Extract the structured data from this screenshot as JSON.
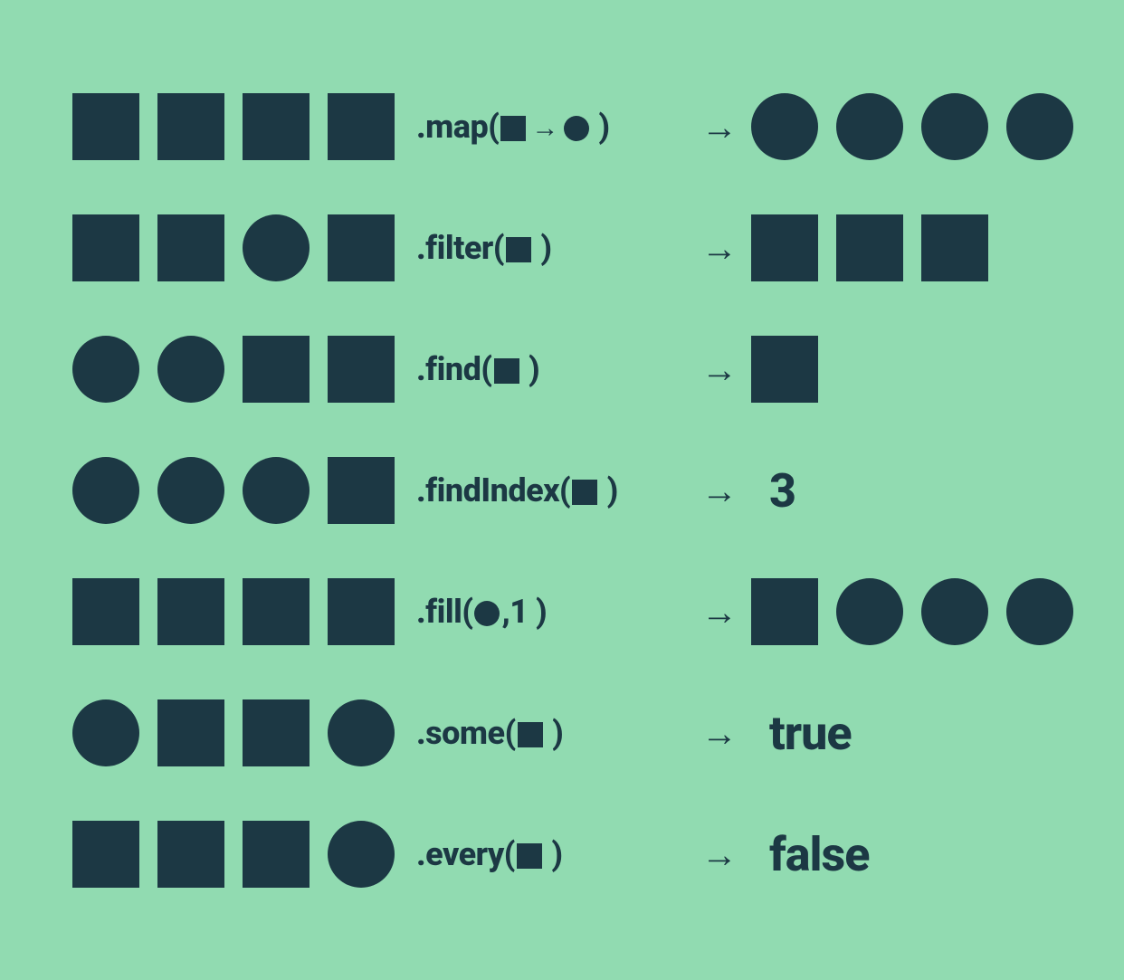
{
  "colors": {
    "bg": "#91dbb1",
    "fg": "#1c3844"
  },
  "arrow_glyph": "→",
  "rows": [
    {
      "input": [
        "square",
        "square",
        "square",
        "square"
      ],
      "method": {
        "name": ".map",
        "args": [
          {
            "t": "shape",
            "v": "square"
          },
          {
            "t": "arrow"
          },
          {
            "t": "shape",
            "v": "circle"
          }
        ]
      },
      "output": {
        "type": "shapes",
        "value": [
          "circle",
          "circle",
          "circle",
          "circle"
        ]
      }
    },
    {
      "input": [
        "square",
        "square",
        "circle",
        "square"
      ],
      "method": {
        "name": ".filter",
        "args": [
          {
            "t": "shape",
            "v": "square"
          }
        ]
      },
      "output": {
        "type": "shapes",
        "value": [
          "square",
          "square",
          "square"
        ]
      }
    },
    {
      "input": [
        "circle",
        "circle",
        "square",
        "square"
      ],
      "method": {
        "name": ".find",
        "args": [
          {
            "t": "shape",
            "v": "square"
          }
        ]
      },
      "output": {
        "type": "shapes",
        "value": [
          "square"
        ]
      }
    },
    {
      "input": [
        "circle",
        "circle",
        "circle",
        "square"
      ],
      "method": {
        "name": ".findIndex",
        "args": [
          {
            "t": "shape",
            "v": "square"
          }
        ]
      },
      "output": {
        "type": "text",
        "value": "3"
      }
    },
    {
      "input": [
        "square",
        "square",
        "square",
        "square"
      ],
      "method": {
        "name": ".fill",
        "args": [
          {
            "t": "shape",
            "v": "circle"
          },
          {
            "t": "text",
            "v": ","
          },
          {
            "t": "text",
            "v": "1"
          }
        ]
      },
      "output": {
        "type": "shapes",
        "value": [
          "square",
          "circle",
          "circle",
          "circle"
        ]
      }
    },
    {
      "input": [
        "circle",
        "square",
        "square",
        "circle"
      ],
      "method": {
        "name": ".some",
        "args": [
          {
            "t": "shape",
            "v": "square"
          }
        ]
      },
      "output": {
        "type": "text",
        "value": "true"
      }
    },
    {
      "input": [
        "square",
        "square",
        "square",
        "circle"
      ],
      "method": {
        "name": ".every",
        "args": [
          {
            "t": "shape",
            "v": "square"
          }
        ]
      },
      "output": {
        "type": "text",
        "value": "false"
      }
    }
  ]
}
